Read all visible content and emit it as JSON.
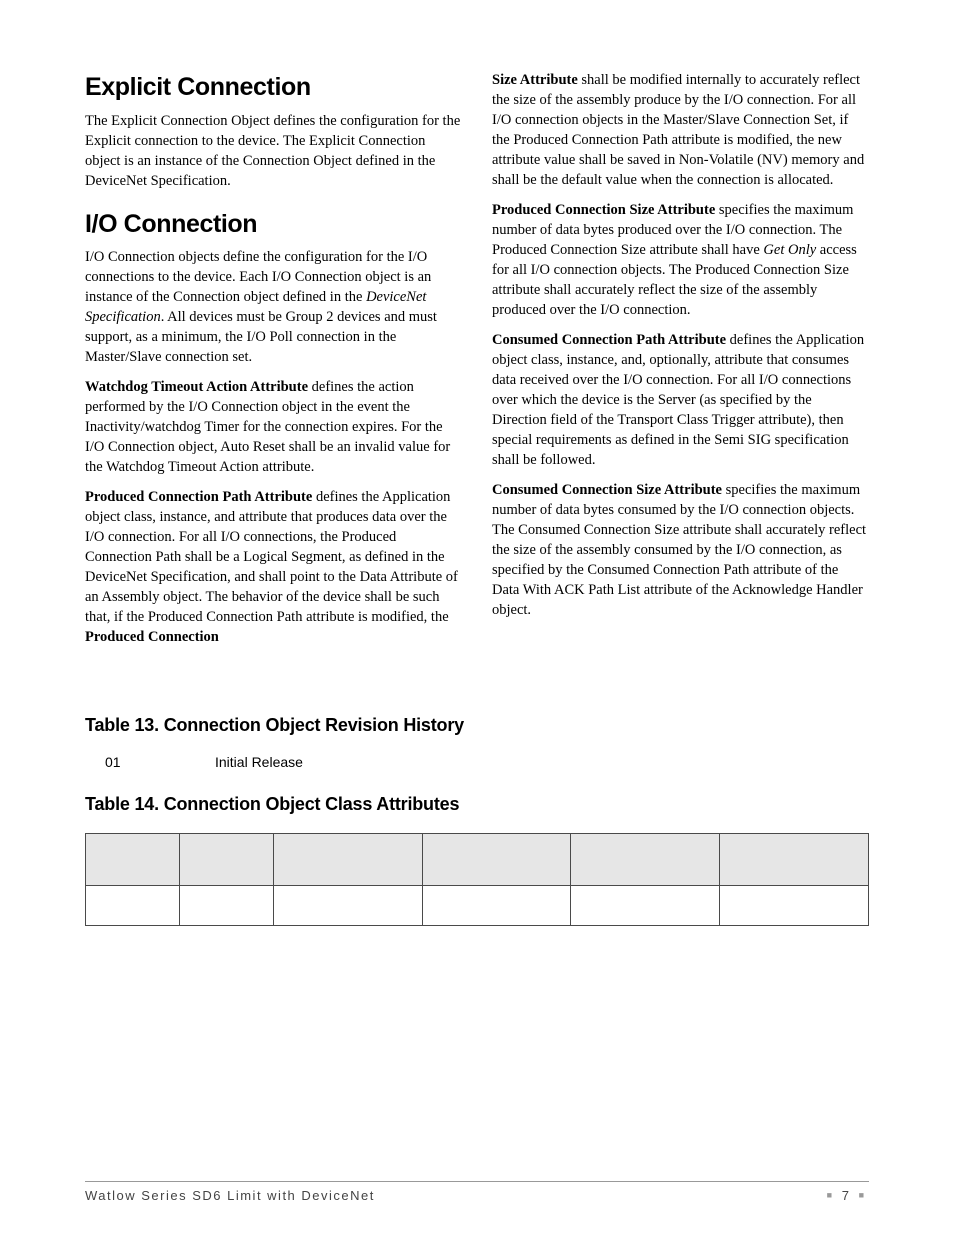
{
  "left": {
    "heading1": "Explicit Connection",
    "p1": "The Explicit Connection Object defines the configuration for the Explicit connection to the device. The Explicit Connection object is an instance of the Connection Object defined in the DeviceNet Specification.",
    "heading2": "I/O Connection",
    "p2a": "I/O Connection objects define the configuration for the I/O connections to the device. Each I/O Connection object is an instance of the Connection object defined in the ",
    "p2b_italic": "DeviceNet Specification",
    "p2c": ". All devices must be Group 2 devices and must support, as a minimum, the I/O Poll connection in the Master/Slave connection set.",
    "p3_bold": "Watchdog Timeout Action Attribute",
    "p3": " defines the action performed by the I/O Connection object in the event the Inactivity/watchdog Timer for the connection expires. For the I/O Connection object, Auto Reset shall be an invalid value for the Watchdog Timeout Action attribute.",
    "p4_bold": "Produced Connection Path Attribute",
    "p4a": " defines the Application object class, instance, and attribute that produces data over the I/O connection. For all I/O connections, the Produced Connection Path shall be a Logical Segment, as defined in the DeviceNet Specification, and shall point to the Data Attribute of an Assembly object. The behavior of the device shall be such that, if the Produced Connection Path attribute is modified, the ",
    "p4b_bold": "Produced Connection"
  },
  "right": {
    "p1_bold": "Size Attribute",
    "p1": " shall be modified internally to accurately reflect the size of the assembly produce by the I/O connection. For all I/O connection objects in the Master/Slave Connection Set, if the Produced Connection Path attribute is modified, the new attribute value shall be saved in Non-Volatile (NV) memory and shall be the default value when the connection is allocated.",
    "p2_bold": "Produced Connection Size Attribute",
    "p2a": " specifies the maximum number of data bytes produced over the I/O connection. The Produced Connection Size attribute shall have ",
    "p2b_italic": "Get Only",
    "p2c": " access for all I/O connection objects. The Produced Connection Size attribute shall accurately reflect the size of the assembly produced over the I/O connection.",
    "p3_bold": "Consumed Connection Path Attribute",
    "p3": " defines the Application object class, instance, and, optionally, attribute that consumes data received over the I/O connection. For all I/O connections over which the device is the Server (as specified by the Direction field of the Transport Class Trigger attribute), then special requirements as defined in the Semi SIG specification shall be followed.",
    "p4_bold": "Consumed Connection Size Attribute",
    "p4": " specifies the maximum number of data bytes consumed by the I/O connection objects. The Consumed Connection Size attribute shall accurately reflect the size of the assembly consumed by the I/O connection, as specified by the Consumed Connection Path attribute of the Data With ACK Path List attribute of the Acknowledge Handler object."
  },
  "tables": {
    "t13_heading": "Table 13. Connection Object Revision History",
    "rev_num": "01",
    "rev_text": "Initial Release",
    "t14_heading": "Table 14. Connection Object Class Attributes"
  },
  "footer": {
    "left": "Watlow Series SD6 Limit with DeviceNet",
    "page": "7"
  }
}
